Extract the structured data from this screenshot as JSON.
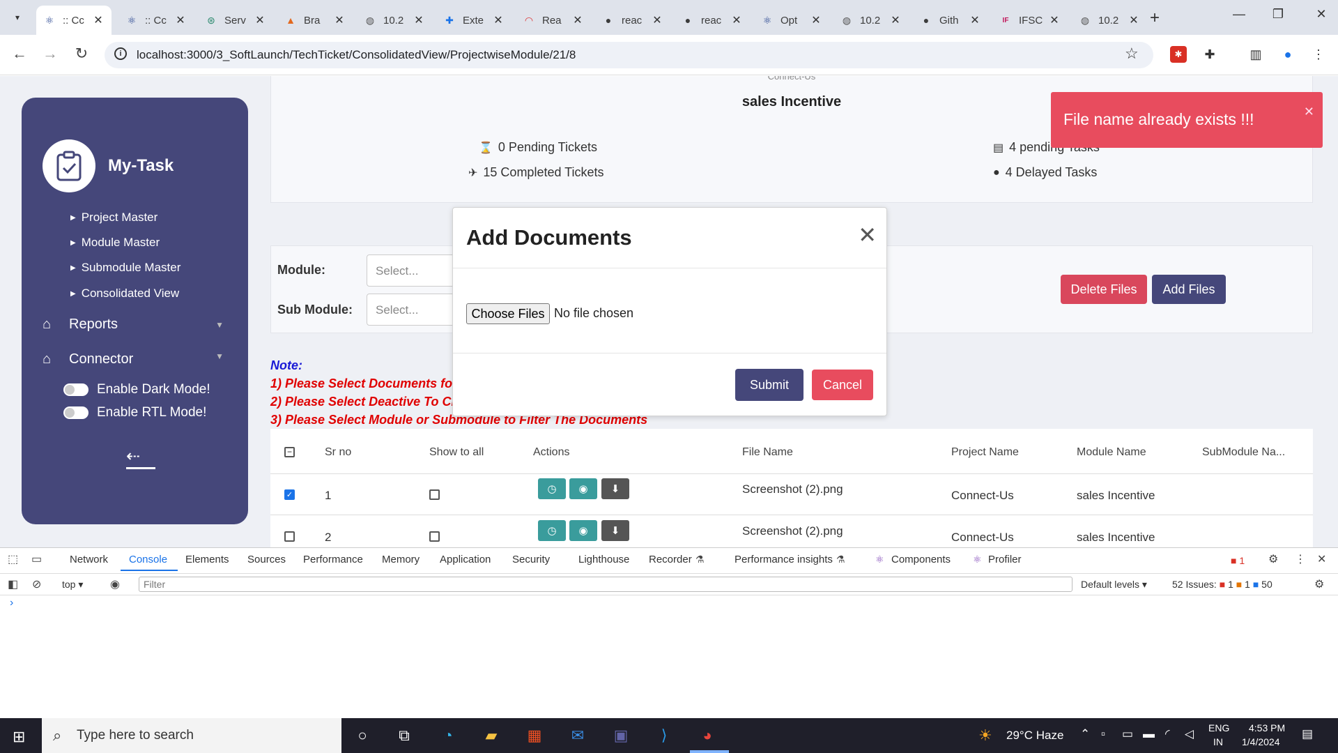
{
  "browser": {
    "tabs": [
      {
        "title": ":: Cc",
        "icon": "react-icon",
        "active": true
      },
      {
        "title": ":: Cc",
        "icon": "react-icon"
      },
      {
        "title": "Serv",
        "icon": "chatgpt-icon"
      },
      {
        "title": "Bra",
        "icon": "brave-icon"
      },
      {
        "title": "10.2",
        "icon": "globe-icon"
      },
      {
        "title": "Exte",
        "icon": "puzzle-icon"
      },
      {
        "title": "Rea",
        "icon": "rainbow-icon"
      },
      {
        "title": "reac",
        "icon": "github-icon"
      },
      {
        "title": "reac",
        "icon": "github-icon"
      },
      {
        "title": "Opt",
        "icon": "react-icon"
      },
      {
        "title": "10.2",
        "icon": "globe-icon"
      },
      {
        "title": "Gith",
        "icon": "github-icon"
      },
      {
        "title": "IFSC",
        "icon": "ifsc-icon"
      },
      {
        "title": "10.2",
        "icon": "globe-icon"
      }
    ],
    "url": "localhost:3000/3_SoftLaunch/TechTicket/ConsolidatedView/ProjectwiseModule/21/8"
  },
  "sidebar": {
    "brand": "My-Task",
    "sub_items": [
      "Project Master",
      "Module Master",
      "Submodule Master",
      "Consolidated View"
    ],
    "reports": "Reports",
    "connector": "Connector",
    "dark_mode": "Enable Dark Mode!",
    "rtl_mode": "Enable RTL Mode!"
  },
  "summary": {
    "top_faded": "Connect-Us",
    "title": "sales Incentive",
    "pending_tickets": "0 Pending Tickets",
    "completed_tickets": "15 Completed Tickets",
    "pending_tasks": "4 pending Tasks",
    "delayed_tasks": "4 Delayed Tasks"
  },
  "filters": {
    "module_label": "Module:",
    "submodule_label": "Sub Module:",
    "placeholder": "Select..."
  },
  "buttons": {
    "delete_files": "Delete Files",
    "add_files": "Add Files"
  },
  "note": {
    "title": "Note:",
    "line1": "1) Please Select Documents fo",
    "line2": "2) Please Select Deactive To Cl",
    "line3": "3) Please Select Module or Submodule to Filter The Documents"
  },
  "table": {
    "headers": [
      "Sr no",
      "Show to all",
      "Actions",
      "File Name",
      "Project Name",
      "Module Name",
      "SubModule Na..."
    ],
    "rows": [
      {
        "sr": "1",
        "file": "Screenshot (2).png",
        "project": "Connect-Us",
        "module": "sales Incentive",
        "checked": true
      },
      {
        "sr": "2",
        "file": "Screenshot (2).png",
        "project": "Connect-Us",
        "module": "sales Incentive",
        "checked": false
      }
    ]
  },
  "toast": {
    "message": "File name already exists !!!"
  },
  "modal": {
    "title": "Add Documents",
    "choose_files": "Choose Files",
    "no_file": "No file chosen",
    "submit": "Submit",
    "cancel": "Cancel"
  },
  "devtools": {
    "tabs": [
      "Network",
      "Console",
      "Elements",
      "Sources",
      "Performance",
      "Memory",
      "Application",
      "Security",
      "Lighthouse",
      "Recorder",
      "Performance insights",
      "Components",
      "Profiler"
    ],
    "active_tab": "Console",
    "context": "top",
    "filter_placeholder": "Filter",
    "levels": "Default levels",
    "issues_label": "52 Issues:",
    "issues_errors": "1",
    "issues_warnings": "1",
    "issues_info": "50",
    "error_count": "1"
  },
  "taskbar": {
    "search_placeholder": "Type here to search",
    "weather": "29°C Haze",
    "lang": "ENG",
    "region": "IN",
    "time": "4:53 PM",
    "date": "1/4/2024"
  },
  "colors": {
    "sidebar": "#45477a",
    "primary": "#45477a",
    "danger": "#d9475c",
    "toast": "#e84c5e",
    "teal": "#3a9c9c"
  }
}
